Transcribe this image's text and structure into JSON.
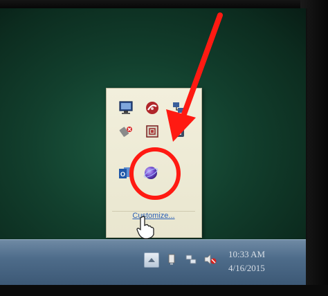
{
  "tray_popup": {
    "customize_label": "Customize...",
    "icons": [
      "display-icon",
      "red-app-icon",
      "network-icon",
      "usb-eject-icon",
      "shield-icon",
      "lock-icon",
      "outlook-icon",
      "purple-globe-icon"
    ]
  },
  "taskbar": {
    "clock_time": "10:33 AM",
    "clock_date": "4/16/2015",
    "tray_icons": [
      "show-hidden-icons-arrow-icon",
      "power-plug-icon",
      "network-icon",
      "muted-speaker-icon"
    ]
  },
  "annotation": {
    "arrow_color": "#ff1a12",
    "circle_color": "#ff1a12"
  }
}
